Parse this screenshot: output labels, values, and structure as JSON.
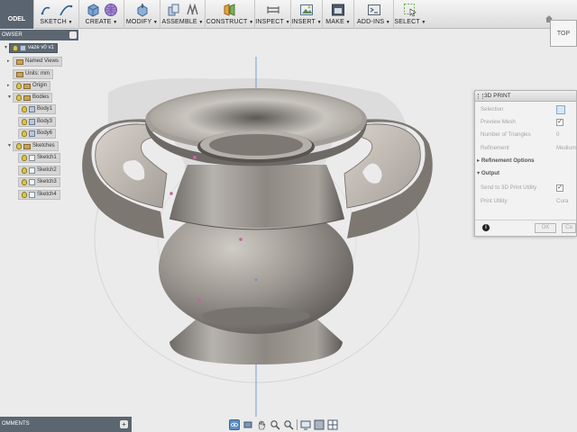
{
  "toolbar": {
    "model_label": "ODEL",
    "groups": [
      {
        "label": "SKETCH"
      },
      {
        "label": "CREATE"
      },
      {
        "label": "MODIFY"
      },
      {
        "label": "ASSEMBLE"
      },
      {
        "label": "CONSTRUCT"
      },
      {
        "label": "INSPECT"
      },
      {
        "label": "INSERT"
      },
      {
        "label": "MAKE"
      },
      {
        "label": "ADD-INS"
      },
      {
        "label": "SELECT"
      }
    ]
  },
  "browser": {
    "title": "OWSER",
    "root": "vaze v0 v1",
    "items": [
      {
        "label": "Named Views"
      },
      {
        "label": "Units: mm"
      },
      {
        "label": "Origin"
      },
      {
        "label": "Bodies"
      },
      {
        "label": "Body1"
      },
      {
        "label": "Body3"
      },
      {
        "label": "Body6"
      },
      {
        "label": "Sketches"
      },
      {
        "label": "Sketch1"
      },
      {
        "label": "Sketch2"
      },
      {
        "label": "Sketch3"
      },
      {
        "label": "Sketch4"
      }
    ]
  },
  "viewcube": {
    "label": "TOP"
  },
  "print_panel": {
    "title": "3D PRINT",
    "rows": [
      {
        "label": "Selection",
        "value": ""
      },
      {
        "label": "Preview Mesh",
        "value": "checked"
      },
      {
        "label": "Number of Triangles",
        "value": "0"
      },
      {
        "label": "Refinement",
        "value": "Medium"
      }
    ],
    "refinement_options_label": "Refinement Options",
    "output_label": "Output",
    "send_label": "Send to 3D Print Utility",
    "utility_label": "Print Utility",
    "utility_value": "Cura",
    "ok_label": "OK",
    "cancel_label": "Ca"
  },
  "comments": {
    "label": "OMMENTS"
  },
  "colors": {
    "toolbar_bg": "#dcdcdc",
    "panel_header": "#5b6671",
    "canvas_bg": "#ebebeb",
    "vase_metal": "#8f8a84",
    "accent_blue": "#5e8fc0"
  }
}
